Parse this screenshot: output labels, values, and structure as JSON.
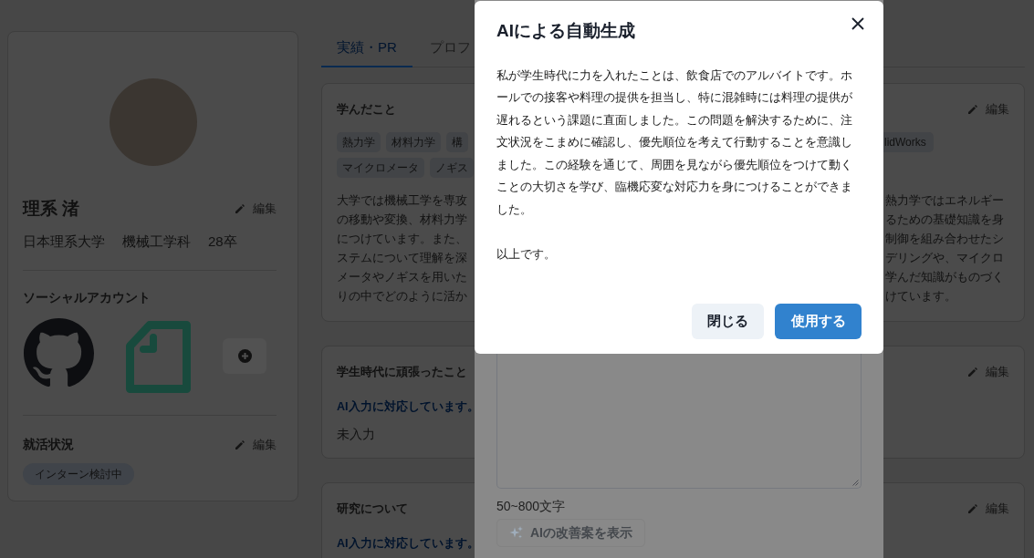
{
  "profile": {
    "name": "理系 渚",
    "edit_label": "編集",
    "affiliation": [
      "日本理系大学",
      "機械工学科",
      "28卒"
    ]
  },
  "social": {
    "title": "ソーシャルアカウント"
  },
  "job_status": {
    "title": "就活状況",
    "edit_label": "編集",
    "tags": [
      "インターン検討中"
    ]
  },
  "tabs": [
    {
      "label": "実績・PR",
      "selected": true
    },
    {
      "label": "プロフ",
      "selected": false
    }
  ],
  "cards": [
    {
      "title": "学んだこと",
      "edit_label": "編集",
      "tag_rows": [
        {
          "left": [
            "熱力学",
            "材料力学",
            "構"
          ],
          "right": [
            "lidWorks"
          ]
        },
        {
          "left": [
            "マイクロメータ",
            "ノギス"
          ]
        }
      ],
      "text_left": [
        "大学では機械工学を専攻",
        "の移動や変換、材料力学",
        "につけています。また、",
        "ステムについて理解を深",
        "メータやノギスを用いた",
        "りの中でどのように活か"
      ],
      "text_right": [
        "熱力学ではエネルギー",
        "るための基礎知識を身",
        "制御を組み合わせたシ",
        "デリングや、マイクロ",
        "学んだ知識がものづく",
        "けています。"
      ]
    },
    {
      "title": "学生時代に頑張ったこと",
      "edit_label": "編集",
      "ai_note": "AI入力に対応しています。",
      "value": "未入力"
    },
    {
      "title": "研究について",
      "edit_label": "編集",
      "ai_note": "AI入力に対応しています。"
    }
  ],
  "drawer": {
    "char_limit": "50~800文字",
    "improve_button": {
      "label": "AIの改善案を表示",
      "disabled": true
    }
  },
  "dialog": {
    "title": "AIによる自動生成",
    "paragraphs": [
      "私が学生時代に力を入れたことは、飲食店でのアルバイトです。ホールでの接客や料理の提供を担当し、特に混雑時には料理の提供が遅れるという課題に直面しました。この問題を解決するために、注文状況をこまめに確認し、優先順位を考えて行動することを意識しました。この経験を通じて、周囲を見ながら優先順位をつけて動くことの大切さを学び、臨機応変な対応力を身につけることができました。",
      "以上です。"
    ],
    "buttons": [
      {
        "label": "閉じる",
        "kind": "secondary"
      },
      {
        "label": "使用する",
        "kind": "primary"
      }
    ]
  }
}
